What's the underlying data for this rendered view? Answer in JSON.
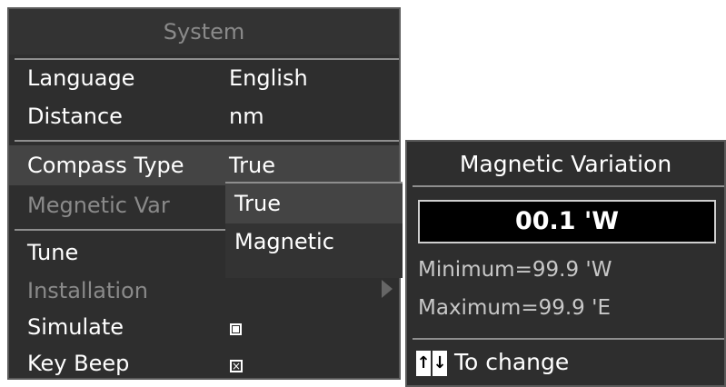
{
  "system": {
    "title": "System",
    "rows": {
      "language": {
        "label": "Language",
        "value": "English"
      },
      "distance": {
        "label": "Distance",
        "value": "nm"
      },
      "compass_type": {
        "label": "Compass Type",
        "value": "True"
      },
      "megnetic_var": {
        "label": "Megnetic Var"
      },
      "tune": {
        "label": "Tune"
      },
      "installation": {
        "label": "Installation"
      },
      "simulate": {
        "label": "Simulate",
        "checked": true
      },
      "key_beep": {
        "label": "Key Beep",
        "checked": true
      }
    },
    "dropdown": {
      "options": [
        "True",
        "Magnetic"
      ],
      "selected": "True"
    }
  },
  "magnetic_variation": {
    "title": "Magnetic Variation",
    "value": "00.1 'W",
    "minimum": "Minimum=99.9 'W",
    "maximum": "Maximum=99.9 'E",
    "hint_arrows": "↑↓",
    "hint": "To change"
  },
  "icons": {
    "submenu": "chevron-right-icon",
    "arrows": "up-down-arrow-icon"
  },
  "colors": {
    "panel_bg": "#2e2e2e",
    "highlight": "#444444",
    "disabled_text": "#8a8a8a",
    "value_box_bg": "#000000"
  }
}
